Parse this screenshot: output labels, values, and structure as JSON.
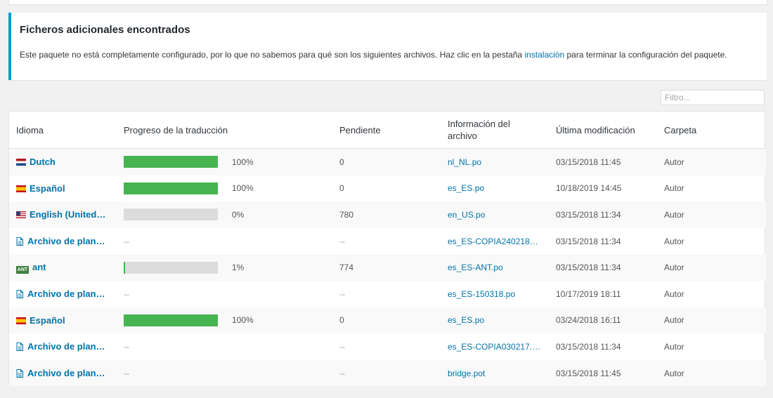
{
  "notice": {
    "title": "Ficheros adicionales encontrados",
    "text_before": "Este paquete no está completamente configurado, por lo que no sabemos para qué son los siguientes archivos. Haz clic en la pestaña ",
    "link": "instalación",
    "text_after": " para terminar la configuración del paquete."
  },
  "filter": {
    "placeholder": "Filtro..."
  },
  "columns": {
    "language": "Idioma",
    "progress": "Progreso de la traducción",
    "pending": "Pendiente",
    "file_info": "Información del archivo",
    "modified": "Última modificación",
    "folder": "Carpeta"
  },
  "colors": {
    "accent": "#0073aa",
    "progress": "#46b450",
    "notice_border": "#00a0d2"
  },
  "rows": [
    {
      "icon": "flag-nl-icon",
      "language": "Dutch",
      "progress": 1.0,
      "percent": "100%",
      "pending": "0",
      "file": "nl_NL.po",
      "modified": "03/15/2018 11:45",
      "folder": "Autor"
    },
    {
      "icon": "flag-es-icon",
      "language": "Español",
      "progress": 1.0,
      "percent": "100%",
      "pending": "0",
      "file": "es_ES.po",
      "modified": "10/18/2019 14:45",
      "folder": "Autor"
    },
    {
      "icon": "flag-us-icon",
      "language": "English (United…",
      "progress": 0.0,
      "percent": "0%",
      "pending": "780",
      "file": "en_US.po",
      "modified": "03/15/2018 11:34",
      "folder": "Autor"
    },
    {
      "icon": "document-icon",
      "language": "Archivo de plan…",
      "progress": null,
      "percent": "--",
      "pending": "--",
      "file": "es_ES-COPIA240218…",
      "modified": "03/15/2018 11:34",
      "folder": "Autor"
    },
    {
      "icon": "flag-ant-icon",
      "icon_text": "ANT",
      "language": "ant",
      "progress": 0.01,
      "percent": "1%",
      "pending": "774",
      "file": "es_ES-ANT.po",
      "modified": "03/15/2018 11:34",
      "folder": "Autor"
    },
    {
      "icon": "document-icon",
      "language": "Archivo de plan…",
      "progress": null,
      "percent": "--",
      "pending": "--",
      "file": "es_ES-150318.po",
      "modified": "10/17/2019 18:11",
      "folder": "Autor"
    },
    {
      "icon": "flag-es-icon",
      "language": "Español",
      "progress": 1.0,
      "percent": "100%",
      "pending": "0",
      "file": "es_ES.po",
      "modified": "03/24/2018 16:11",
      "folder": "Autor"
    },
    {
      "icon": "document-icon",
      "language": "Archivo de plan…",
      "progress": null,
      "percent": "--",
      "pending": "--",
      "file": "es_ES-COPIA030217.…",
      "modified": "03/15/2018 11:34",
      "folder": "Autor"
    },
    {
      "icon": "document-icon",
      "language": "Archivo de plan…",
      "progress": null,
      "percent": "--",
      "pending": "--",
      "file": "bridge.pot",
      "modified": "03/15/2018 11:45",
      "folder": "Autor"
    }
  ]
}
